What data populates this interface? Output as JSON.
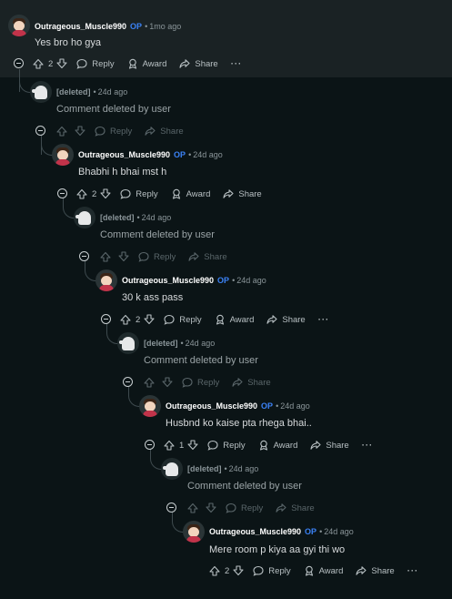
{
  "comments": [
    {
      "author": "Outrageous_Muscle990",
      "op": "OP",
      "time": "1mo ago",
      "body": "Yes bro ho gya",
      "score": "2",
      "reply": "Reply",
      "award": "Award",
      "share": "Share",
      "more": "···"
    },
    {
      "author": "[deleted]",
      "time": "24d ago",
      "body": "Comment deleted by user",
      "reply": "Reply",
      "share": "Share"
    },
    {
      "author": "Outrageous_Muscle990",
      "op": "OP",
      "time": "24d ago",
      "body": "Bhabhi h bhai mst h",
      "score": "2",
      "reply": "Reply",
      "award": "Award",
      "share": "Share",
      "more": "···"
    },
    {
      "author": "[deleted]",
      "time": "24d ago",
      "body": "Comment deleted by user",
      "reply": "Reply",
      "share": "Share"
    },
    {
      "author": "Outrageous_Muscle990",
      "op": "OP",
      "time": "24d ago",
      "body": "30 k ass pass",
      "score": "2",
      "reply": "Reply",
      "award": "Award",
      "share": "Share",
      "more": "···"
    },
    {
      "author": "[deleted]",
      "time": "24d ago",
      "body": "Comment deleted by user",
      "reply": "Reply",
      "share": "Share"
    },
    {
      "author": "Outrageous_Muscle990",
      "op": "OP",
      "time": "24d ago",
      "body": "Husbnd ko kaise pta rhega bhai..",
      "score": "1",
      "reply": "Reply",
      "award": "Award",
      "share": "Share",
      "more": "···"
    },
    {
      "author": "[deleted]",
      "time": "24d ago",
      "body": "Comment deleted by user",
      "reply": "Reply",
      "share": "Share"
    },
    {
      "author": "Outrageous_Muscle990",
      "op": "OP",
      "time": "24d ago",
      "body": "Mere room p kiya aa gyi thi wo",
      "score": "2",
      "reply": "Reply",
      "award": "Award",
      "share": "Share",
      "more": "···"
    }
  ],
  "meta_sep": "•",
  "colors": {
    "background": "#0b1416",
    "highlight": "#1a2224",
    "op_badge": "#3b82f6",
    "thread_line": "#3e4a4e"
  },
  "icons": [
    "avatar",
    "ghost-avatar",
    "upvote-icon",
    "downvote-icon",
    "reply-icon",
    "award-icon",
    "share-icon",
    "collapse-icon"
  ]
}
